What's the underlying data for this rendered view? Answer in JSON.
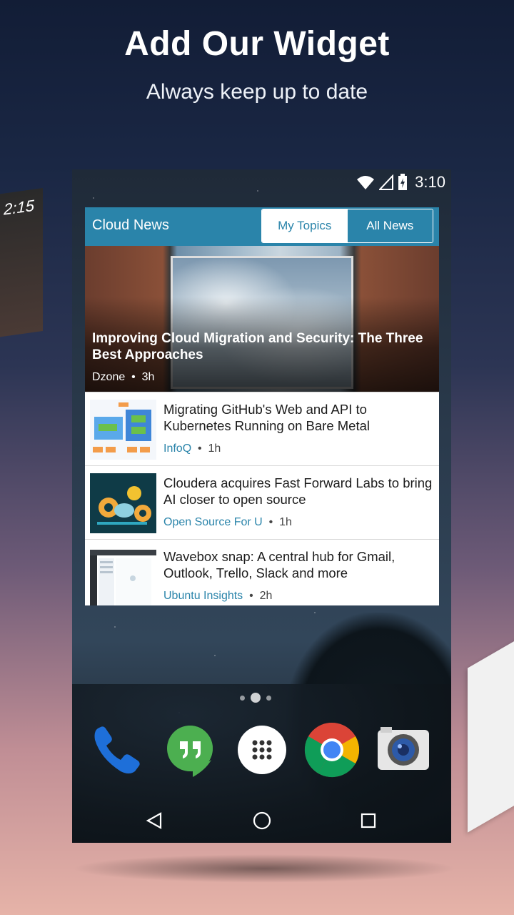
{
  "promo": {
    "headline": "Add Our Widget",
    "subline": "Always keep up to date"
  },
  "side_phone_left": {
    "clock": "2:15"
  },
  "statusbar": {
    "time": "3:10"
  },
  "widget": {
    "title": "Cloud News",
    "tabs": [
      {
        "label": "My Topics",
        "active": false
      },
      {
        "label": "All News",
        "active": true
      }
    ],
    "hero": {
      "title": "Improving Cloud Migration and Security: The Three Best Approaches",
      "source": "Dzone",
      "age": "3h"
    },
    "items": [
      {
        "title": "Migrating GitHub's Web and API to Kubernetes Running on Bare Metal",
        "source": "InfoQ",
        "age": "1h"
      },
      {
        "title": "Cloudera acquires Fast Forward Labs to bring AI closer to open source",
        "source": "Open Source For U",
        "age": "1h"
      },
      {
        "title": "Wavebox snap: A central hub for Gmail, Outlook, Trello, Slack and more",
        "source": "Ubuntu Insights",
        "age": "2h"
      }
    ],
    "separator": "•"
  },
  "dock": {
    "icons": [
      "phone-icon",
      "hangouts-icon",
      "app-drawer-icon",
      "chrome-icon",
      "camera-icon"
    ]
  },
  "colors": {
    "accent": "#2a84aa",
    "hangouts": "#4caf50",
    "phone": "#1e6fd9"
  }
}
